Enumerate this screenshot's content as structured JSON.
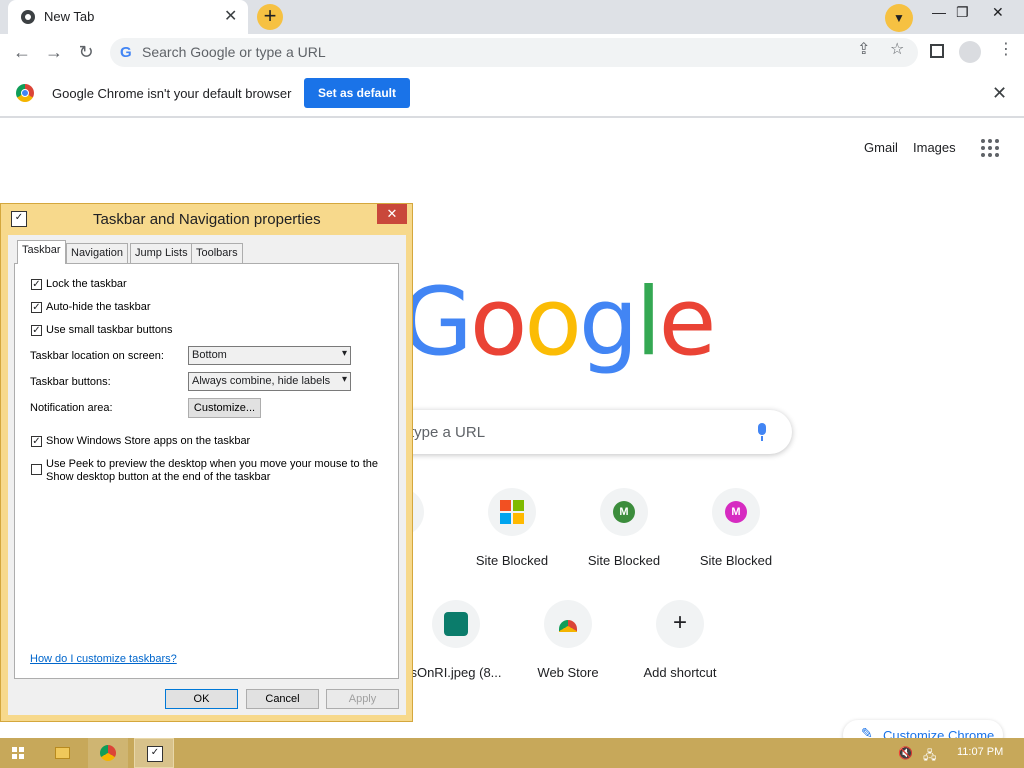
{
  "browser": {
    "tab_title": "New Tab",
    "new_tab_symbol": "+",
    "tab_close_symbol": "✕",
    "omnibox_placeholder": "Search Google or type a URL",
    "window_controls": [
      "—",
      "❐",
      "✕"
    ]
  },
  "infobar": {
    "message": "Google Chrome isn't your default browser",
    "button": "Set as default",
    "close_symbol": "✕"
  },
  "ntp": {
    "links": [
      "Gmail",
      "Images"
    ],
    "logo_letters": [
      {
        "ch": "G",
        "color": "#4285f4"
      },
      {
        "ch": "o",
        "color": "#ea4335"
      },
      {
        "ch": "o",
        "color": "#fbbc05"
      },
      {
        "ch": "g",
        "color": "#4285f4"
      },
      {
        "ch": "l",
        "color": "#34a853"
      },
      {
        "ch": "e",
        "color": "#ea4335"
      }
    ],
    "search_placeholder": "type a URL",
    "shortcuts_row1": [
      {
        "label": "ked",
        "icon": "blank"
      },
      {
        "label": "Site Blocked",
        "icon": "microsoft-logo"
      },
      {
        "label": "Site Blocked",
        "icon": "letter",
        "letter": "M",
        "color": "#3c8d3c"
      },
      {
        "label": "Site Blocked",
        "icon": "letter",
        "letter": "M",
        "color": "#d62bc1"
      }
    ],
    "shortcuts_row2": [
      {
        "label": "sOnRI.jpeg (8...",
        "icon": "image"
      },
      {
        "label": "Web Store",
        "icon": "webstore"
      },
      {
        "label": "Add shortcut",
        "icon": "plus"
      }
    ],
    "customize": "Customize Chrome"
  },
  "dialog": {
    "title": "Taskbar and Navigation properties",
    "close_symbol": "✕",
    "tabs": [
      "Taskbar",
      "Navigation",
      "Jump Lists",
      "Toolbars"
    ],
    "checkboxes": {
      "lock": {
        "label": "Lock the taskbar",
        "checked": true
      },
      "autohide": {
        "label": "Auto-hide the taskbar",
        "checked": true
      },
      "small": {
        "label": "Use small taskbar buttons",
        "checked": true
      },
      "store": {
        "label": "Show Windows Store apps on the taskbar",
        "checked": true
      },
      "peek": {
        "label": "Use Peek to preview the desktop when you move your mouse to the Show desktop button at the end of the taskbar",
        "checked": false
      }
    },
    "location_label": "Taskbar location on screen:",
    "location_value": "Bottom",
    "buttons_label": "Taskbar buttons:",
    "buttons_value": "Always combine, hide labels",
    "notification_label": "Notification area:",
    "customize_button": "Customize...",
    "help_link": "How do I customize taskbars?",
    "ok": "OK",
    "cancel": "Cancel",
    "apply": "Apply"
  },
  "taskbar": {
    "clock": "11:07 PM"
  }
}
